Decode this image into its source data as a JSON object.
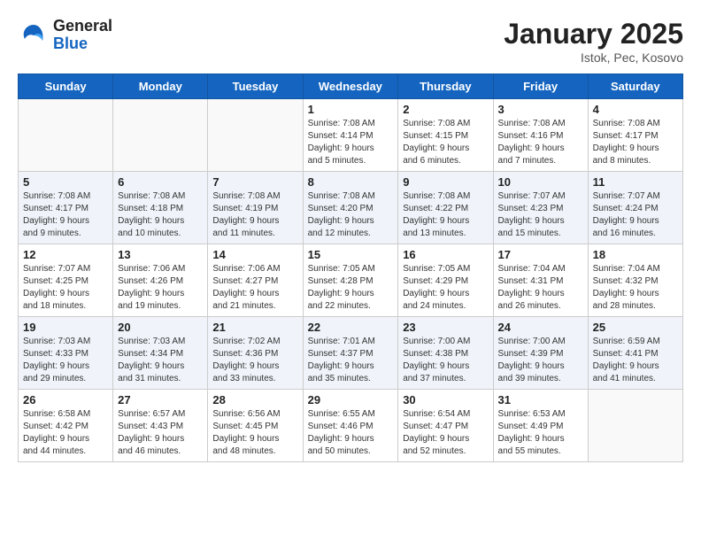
{
  "header": {
    "logo_general": "General",
    "logo_blue": "Blue",
    "month_title": "January 2025",
    "location": "Istok, Pec, Kosovo"
  },
  "weekdays": [
    "Sunday",
    "Monday",
    "Tuesday",
    "Wednesday",
    "Thursday",
    "Friday",
    "Saturday"
  ],
  "weeks": [
    [
      {
        "day": "",
        "info": ""
      },
      {
        "day": "",
        "info": ""
      },
      {
        "day": "",
        "info": ""
      },
      {
        "day": "1",
        "info": "Sunrise: 7:08 AM\nSunset: 4:14 PM\nDaylight: 9 hours\nand 5 minutes."
      },
      {
        "day": "2",
        "info": "Sunrise: 7:08 AM\nSunset: 4:15 PM\nDaylight: 9 hours\nand 6 minutes."
      },
      {
        "day": "3",
        "info": "Sunrise: 7:08 AM\nSunset: 4:16 PM\nDaylight: 9 hours\nand 7 minutes."
      },
      {
        "day": "4",
        "info": "Sunrise: 7:08 AM\nSunset: 4:17 PM\nDaylight: 9 hours\nand 8 minutes."
      }
    ],
    [
      {
        "day": "5",
        "info": "Sunrise: 7:08 AM\nSunset: 4:17 PM\nDaylight: 9 hours\nand 9 minutes."
      },
      {
        "day": "6",
        "info": "Sunrise: 7:08 AM\nSunset: 4:18 PM\nDaylight: 9 hours\nand 10 minutes."
      },
      {
        "day": "7",
        "info": "Sunrise: 7:08 AM\nSunset: 4:19 PM\nDaylight: 9 hours\nand 11 minutes."
      },
      {
        "day": "8",
        "info": "Sunrise: 7:08 AM\nSunset: 4:20 PM\nDaylight: 9 hours\nand 12 minutes."
      },
      {
        "day": "9",
        "info": "Sunrise: 7:08 AM\nSunset: 4:22 PM\nDaylight: 9 hours\nand 13 minutes."
      },
      {
        "day": "10",
        "info": "Sunrise: 7:07 AM\nSunset: 4:23 PM\nDaylight: 9 hours\nand 15 minutes."
      },
      {
        "day": "11",
        "info": "Sunrise: 7:07 AM\nSunset: 4:24 PM\nDaylight: 9 hours\nand 16 minutes."
      }
    ],
    [
      {
        "day": "12",
        "info": "Sunrise: 7:07 AM\nSunset: 4:25 PM\nDaylight: 9 hours\nand 18 minutes."
      },
      {
        "day": "13",
        "info": "Sunrise: 7:06 AM\nSunset: 4:26 PM\nDaylight: 9 hours\nand 19 minutes."
      },
      {
        "day": "14",
        "info": "Sunrise: 7:06 AM\nSunset: 4:27 PM\nDaylight: 9 hours\nand 21 minutes."
      },
      {
        "day": "15",
        "info": "Sunrise: 7:05 AM\nSunset: 4:28 PM\nDaylight: 9 hours\nand 22 minutes."
      },
      {
        "day": "16",
        "info": "Sunrise: 7:05 AM\nSunset: 4:29 PM\nDaylight: 9 hours\nand 24 minutes."
      },
      {
        "day": "17",
        "info": "Sunrise: 7:04 AM\nSunset: 4:31 PM\nDaylight: 9 hours\nand 26 minutes."
      },
      {
        "day": "18",
        "info": "Sunrise: 7:04 AM\nSunset: 4:32 PM\nDaylight: 9 hours\nand 28 minutes."
      }
    ],
    [
      {
        "day": "19",
        "info": "Sunrise: 7:03 AM\nSunset: 4:33 PM\nDaylight: 9 hours\nand 29 minutes."
      },
      {
        "day": "20",
        "info": "Sunrise: 7:03 AM\nSunset: 4:34 PM\nDaylight: 9 hours\nand 31 minutes."
      },
      {
        "day": "21",
        "info": "Sunrise: 7:02 AM\nSunset: 4:36 PM\nDaylight: 9 hours\nand 33 minutes."
      },
      {
        "day": "22",
        "info": "Sunrise: 7:01 AM\nSunset: 4:37 PM\nDaylight: 9 hours\nand 35 minutes."
      },
      {
        "day": "23",
        "info": "Sunrise: 7:00 AM\nSunset: 4:38 PM\nDaylight: 9 hours\nand 37 minutes."
      },
      {
        "day": "24",
        "info": "Sunrise: 7:00 AM\nSunset: 4:39 PM\nDaylight: 9 hours\nand 39 minutes."
      },
      {
        "day": "25",
        "info": "Sunrise: 6:59 AM\nSunset: 4:41 PM\nDaylight: 9 hours\nand 41 minutes."
      }
    ],
    [
      {
        "day": "26",
        "info": "Sunrise: 6:58 AM\nSunset: 4:42 PM\nDaylight: 9 hours\nand 44 minutes."
      },
      {
        "day": "27",
        "info": "Sunrise: 6:57 AM\nSunset: 4:43 PM\nDaylight: 9 hours\nand 46 minutes."
      },
      {
        "day": "28",
        "info": "Sunrise: 6:56 AM\nSunset: 4:45 PM\nDaylight: 9 hours\nand 48 minutes."
      },
      {
        "day": "29",
        "info": "Sunrise: 6:55 AM\nSunset: 4:46 PM\nDaylight: 9 hours\nand 50 minutes."
      },
      {
        "day": "30",
        "info": "Sunrise: 6:54 AM\nSunset: 4:47 PM\nDaylight: 9 hours\nand 52 minutes."
      },
      {
        "day": "31",
        "info": "Sunrise: 6:53 AM\nSunset: 4:49 PM\nDaylight: 9 hours\nand 55 minutes."
      },
      {
        "day": "",
        "info": ""
      }
    ]
  ]
}
